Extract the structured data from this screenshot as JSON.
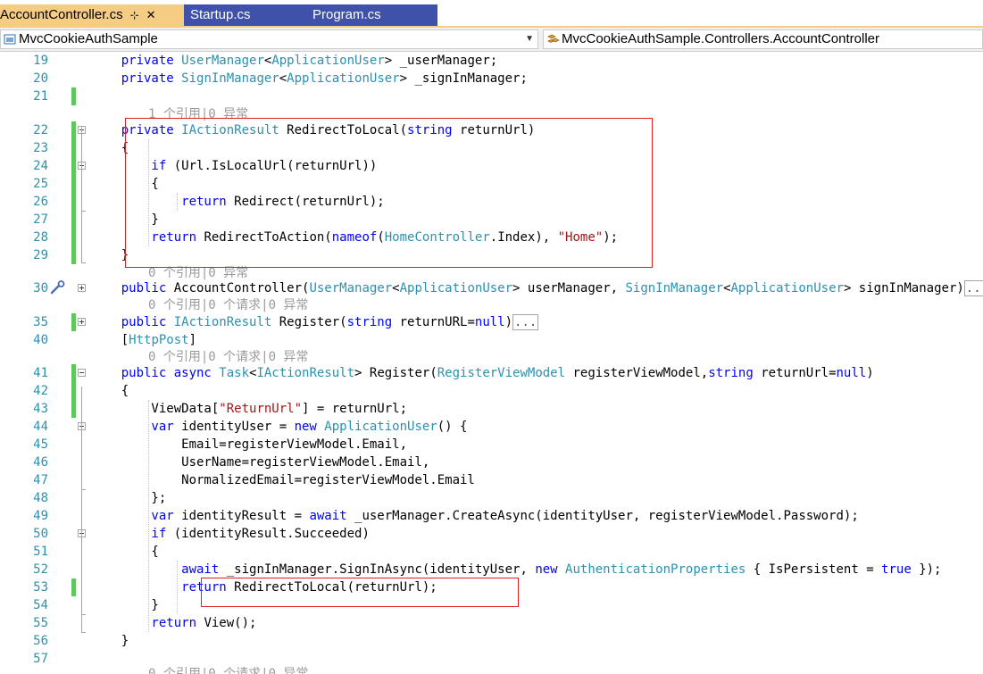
{
  "tabs": [
    {
      "label": "AccountController.cs",
      "active": true
    },
    {
      "label": "Startup.cs",
      "active": false
    },
    {
      "label": "Program.cs",
      "active": false
    }
  ],
  "tab_pin_glyph": "⊹",
  "tab_close_glyph": "✕",
  "nav": {
    "project": "MvcCookieAuthSample",
    "member": "MvcCookieAuthSample.Controllers.AccountController"
  },
  "lenses": {
    "refs1": "1 个引用|0 异常",
    "refs0": "0 个引用|0 异常",
    "refs0req": "0 个引用|0 个请求|0 异常",
    "refs0req2": "0 个引用|0 个请求|0 异常",
    "refs0req3": "0 个引用|0 个请求|0 异常"
  },
  "lines": [
    {
      "n": "19",
      "toks": [
        [
          "kw",
          "    private "
        ],
        [
          "ty",
          "UserManager"
        ],
        [
          "",
          "<"
        ],
        [
          "ty",
          "ApplicationUser"
        ],
        [
          "",
          "> _userManager;"
        ]
      ]
    },
    {
      "n": "20",
      "toks": [
        [
          "kw",
          "    private "
        ],
        [
          "ty",
          "SignInManager"
        ],
        [
          "",
          "<"
        ],
        [
          "ty",
          "ApplicationUser"
        ],
        [
          "",
          "> _signInManager;"
        ]
      ]
    },
    {
      "n": "21",
      "toks": []
    },
    {
      "n": "22",
      "toks": [
        [
          "kw",
          "    private "
        ],
        [
          "ty",
          "IActionResult"
        ],
        [
          "",
          " RedirectToLocal("
        ],
        [
          "kw",
          "string"
        ],
        [
          "",
          " returnUrl)"
        ]
      ]
    },
    {
      "n": "23",
      "toks": [
        [
          "",
          "    {"
        ]
      ]
    },
    {
      "n": "24",
      "toks": [
        [
          "kw",
          "        if"
        ],
        [
          "",
          " (Url.IsLocalUrl(returnUrl))"
        ]
      ]
    },
    {
      "n": "25",
      "toks": [
        [
          "",
          "        {"
        ]
      ]
    },
    {
      "n": "26",
      "toks": [
        [
          "kw",
          "            return"
        ],
        [
          "",
          " Redirect(returnUrl);"
        ]
      ]
    },
    {
      "n": "27",
      "toks": [
        [
          "",
          "        }"
        ]
      ]
    },
    {
      "n": "28",
      "toks": [
        [
          "kw",
          "        return"
        ],
        [
          "",
          " RedirectToAction("
        ],
        [
          "kw",
          "nameof"
        ],
        [
          "",
          "("
        ],
        [
          "ty",
          "HomeController"
        ],
        [
          "",
          ".Index), "
        ],
        [
          "st",
          "\"Home\""
        ],
        [
          "",
          ");"
        ]
      ]
    },
    {
      "n": "29",
      "toks": [
        [
          "",
          "    }"
        ]
      ]
    },
    {
      "n": "30",
      "toks": [
        [
          "kw",
          "    public"
        ],
        [
          "",
          " AccountController("
        ],
        [
          "ty",
          "UserManager"
        ],
        [
          "",
          "<"
        ],
        [
          "ty",
          "ApplicationUser"
        ],
        [
          "",
          "> userManager, "
        ],
        [
          "ty",
          "SignInManager"
        ],
        [
          "",
          "<"
        ],
        [
          "ty",
          "ApplicationUser"
        ],
        [
          "",
          "> signInManager)"
        ],
        [
          "coll",
          "..."
        ]
      ]
    },
    {
      "n": "35",
      "toks": [
        [
          "kw",
          "    public "
        ],
        [
          "ty",
          "IActionResult"
        ],
        [
          "",
          " Register("
        ],
        [
          "kw",
          "string"
        ],
        [
          "",
          " returnURL="
        ],
        [
          "kw",
          "null"
        ],
        [
          "",
          ")"
        ],
        [
          "coll",
          "..."
        ]
      ]
    },
    {
      "n": "40",
      "toks": [
        [
          "",
          "    ["
        ],
        [
          "ty",
          "HttpPost"
        ],
        [
          "",
          "]"
        ]
      ]
    },
    {
      "n": "41",
      "toks": [
        [
          "kw",
          "    public async "
        ],
        [
          "ty",
          "Task"
        ],
        [
          "",
          "<"
        ],
        [
          "ty",
          "IActionResult"
        ],
        [
          "",
          "> Register("
        ],
        [
          "ty",
          "RegisterViewModel"
        ],
        [
          "",
          " registerViewModel,"
        ],
        [
          "kw",
          "string"
        ],
        [
          "",
          " returnUrl="
        ],
        [
          "kw",
          "null"
        ],
        [
          "",
          ")"
        ]
      ]
    },
    {
      "n": "42",
      "toks": [
        [
          "",
          "    {"
        ]
      ]
    },
    {
      "n": "43",
      "toks": [
        [
          "",
          "        ViewData["
        ],
        [
          "st",
          "\"ReturnUrl\""
        ],
        [
          "",
          "] = returnUrl;"
        ]
      ]
    },
    {
      "n": "44",
      "toks": [
        [
          "kw",
          "        var"
        ],
        [
          "",
          " identityUser = "
        ],
        [
          "kw",
          "new "
        ],
        [
          "ty",
          "ApplicationUser"
        ],
        [
          "",
          "() {"
        ]
      ]
    },
    {
      "n": "45",
      "toks": [
        [
          "",
          "            Email=registerViewModel.Email,"
        ]
      ]
    },
    {
      "n": "46",
      "toks": [
        [
          "",
          "            UserName=registerViewModel.Email,"
        ]
      ]
    },
    {
      "n": "47",
      "toks": [
        [
          "",
          "            NormalizedEmail=registerViewModel.Email"
        ]
      ]
    },
    {
      "n": "48",
      "toks": [
        [
          "",
          "        };"
        ]
      ]
    },
    {
      "n": "49",
      "toks": [
        [
          "kw",
          "        var"
        ],
        [
          "",
          " identityResult = "
        ],
        [
          "kw",
          "await"
        ],
        [
          "",
          " _userManager.CreateAsync(identityUser, registerViewModel.Password);"
        ]
      ]
    },
    {
      "n": "50",
      "toks": [
        [
          "kw",
          "        if"
        ],
        [
          "",
          " (identityResult.Succeeded)"
        ]
      ]
    },
    {
      "n": "51",
      "toks": [
        [
          "",
          "        {"
        ]
      ]
    },
    {
      "n": "52",
      "toks": [
        [
          "kw",
          "            await"
        ],
        [
          "",
          " _signInManager.SignInAsync(identityUser, "
        ],
        [
          "kw",
          "new "
        ],
        [
          "ty",
          "AuthenticationProperties"
        ],
        [
          "",
          " { IsPersistent = "
        ],
        [
          "kw",
          "true"
        ],
        [
          "",
          " });"
        ]
      ]
    },
    {
      "n": "53",
      "toks": [
        [
          "kw",
          "            return"
        ],
        [
          "",
          " RedirectToLocal(returnUrl);"
        ]
      ]
    },
    {
      "n": "54",
      "toks": [
        [
          "",
          "        }"
        ]
      ]
    },
    {
      "n": "55",
      "toks": [
        [
          "kw",
          "        return"
        ],
        [
          "",
          " View();"
        ]
      ]
    },
    {
      "n": "56",
      "toks": [
        [
          "",
          "    }"
        ]
      ]
    },
    {
      "n": "57",
      "toks": []
    }
  ],
  "colors": {
    "keyword": "#0000ff",
    "type": "#2b91af",
    "string": "#a31515",
    "changed": "#5cc95c",
    "highlight-box": "#e02020"
  }
}
